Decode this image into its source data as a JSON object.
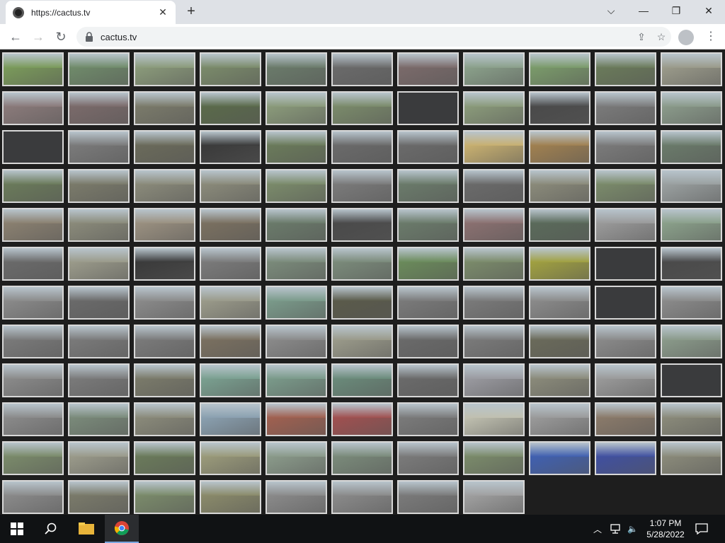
{
  "browser": {
    "tab_title": "https://cactus.tv",
    "url": "cactus.tv",
    "icons": [
      "back-arrow-icon",
      "forward-arrow-icon",
      "reload-icon",
      "lock-icon",
      "share-icon",
      "star-icon",
      "profile-icon",
      "menu-icon"
    ]
  },
  "window_controls": [
    "chevron-down-icon",
    "minimize-icon",
    "restore-icon",
    "close-icon"
  ],
  "grid": {
    "columns": 11,
    "tiles": [
      "#7a9a5a",
      "#6f8a6a",
      "#8a9a7a",
      "#7a8a6a",
      "#6a7a6a",
      "#6a6a6a",
      "#7a6a6a",
      "#8aa08a",
      "#7a9a6a",
      "#6a7a5a",
      "#9a9a8a",
      "#8a7a7a",
      "#7a6a6a",
      "#7a7a6a",
      "#5a6a4a",
      "#8a9a7a",
      "#7a8a6a",
      "dark",
      "#8a9a7a",
      "#4a4a4a",
      "#7a7a7a",
      "#8a9a8a",
      "dark",
      "#7a7a7a",
      "#6a6a5a",
      "#3a3a3a",
      "#6a7a5a",
      "#6a6a6a",
      "#6a6a6a",
      "#c8b070",
      "#a08050",
      "#7a7a7a",
      "#6a7a6a",
      "#6a7a5a",
      "#7a7a6a",
      "#8a8a7a",
      "#8a8a7a",
      "#7a8a6a",
      "#7a7a7a",
      "#6a7a6a",
      "#6a6a6a",
      "#8a8a7a",
      "#7a8a6a",
      "#9aa0a0",
      "#8a8070",
      "#8a8a7a",
      "#9a9080",
      "#7a7060",
      "#6a7a6a",
      "#4a4a4a",
      "#6a7a6a",
      "#8a7070",
      "#5a6a5a",
      "#9a9a9a",
      "#8aa08a",
      "#6a6a6a",
      "#9a9a8a",
      "#3a3a3a",
      "#7a7a7a",
      "#7a8a7a",
      "#7a8a7a",
      "#6a8a5a",
      "#7a8a6a",
      "#a0a040",
      "dark",
      "#4a4a4a",
      "#8a8a8a",
      "#6a6a6a",
      "#8a8a8a",
      "#9a9a8a",
      "#7a9a8a",
      "#5a5a4a",
      "#7a7a7a",
      "#7a7a7a",
      "#8a8a8a",
      "dark",
      "#8a8a8a",
      "#7a7a7a",
      "#7a7a7a",
      "#7a7a7a",
      "#7a7060",
      "#8a8a8a",
      "#9a9a8a",
      "#6a6a6a",
      "#7a7a7a",
      "#6a6a5a",
      "#8a8a8a",
      "#8a9a8a",
      "#8a8a8a",
      "#7a7a7a",
      "#7a7a6a",
      "#7aa090",
      "#7a9a8a",
      "#6a8a7a",
      "#6a6a6a",
      "#9a9aa0",
      "#8a8a7a",
      "#9a9a9a",
      "dark",
      "#8a8a8a",
      "#7a8a7a",
      "#8a8a7a",
      "#8aa0b0",
      "#a06050",
      "#a05050",
      "#7a7a7a",
      "#c0c0b0",
      "#9a9a9a",
      "#8a7a6a",
      "#8a8a7a",
      "#7a8a6a",
      "#9a9a8a",
      "#6a7a5a",
      "#9a9a7a",
      "#8a9a8a",
      "#7a8a7a",
      "#7a7a7a",
      "#7a8a6a",
      "#4060b0",
      "#4050a0",
      "#8a8a7a",
      "#8a8a8a",
      "#7a7a6a",
      "#7a8a6a",
      "#8a8a6a",
      "#8a8a8a",
      "#8a8a8a",
      "#7a7a7a",
      "#a0a0a0"
    ]
  },
  "taskbar": {
    "icons": [
      "windows-start-icon",
      "search-icon",
      "file-explorer-icon",
      "chrome-icon"
    ],
    "tray_icons": [
      "chevron-up-icon",
      "network-icon",
      "volume-icon",
      "notification-icon"
    ],
    "time": "1:07 PM",
    "date": "5/28/2022"
  }
}
